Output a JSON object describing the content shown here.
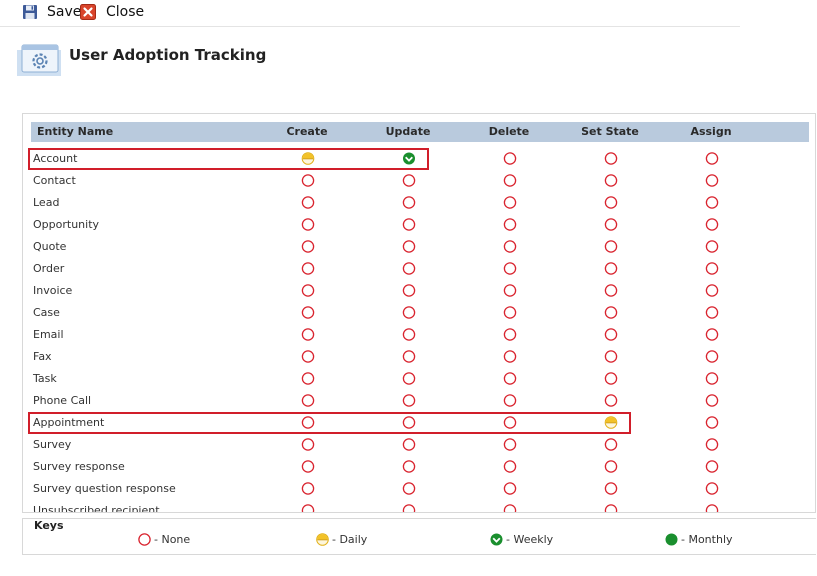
{
  "toolbar": {
    "save_label": "Save",
    "close_label": "Close"
  },
  "header": {
    "title": "User Adoption Tracking"
  },
  "grid": {
    "columns": [
      "Entity Name",
      "Create",
      "Update",
      "Delete",
      "Set State",
      "Assign"
    ],
    "rows": [
      {
        "entity": "Account",
        "states": [
          "daily",
          "weekly",
          "none",
          "none",
          "none"
        ],
        "highlight": true
      },
      {
        "entity": "Contact",
        "states": [
          "none",
          "none",
          "none",
          "none",
          "none"
        ]
      },
      {
        "entity": "Lead",
        "states": [
          "none",
          "none",
          "none",
          "none",
          "none"
        ]
      },
      {
        "entity": "Opportunity",
        "states": [
          "none",
          "none",
          "none",
          "none",
          "none"
        ]
      },
      {
        "entity": "Quote",
        "states": [
          "none",
          "none",
          "none",
          "none",
          "none"
        ]
      },
      {
        "entity": "Order",
        "states": [
          "none",
          "none",
          "none",
          "none",
          "none"
        ]
      },
      {
        "entity": "Invoice",
        "states": [
          "none",
          "none",
          "none",
          "none",
          "none"
        ]
      },
      {
        "entity": "Case",
        "states": [
          "none",
          "none",
          "none",
          "none",
          "none"
        ]
      },
      {
        "entity": "Email",
        "states": [
          "none",
          "none",
          "none",
          "none",
          "none"
        ]
      },
      {
        "entity": "Fax",
        "states": [
          "none",
          "none",
          "none",
          "none",
          "none"
        ]
      },
      {
        "entity": "Task",
        "states": [
          "none",
          "none",
          "none",
          "none",
          "none"
        ]
      },
      {
        "entity": "Phone Call",
        "states": [
          "none",
          "none",
          "none",
          "none",
          "none"
        ]
      },
      {
        "entity": "Appointment",
        "states": [
          "none",
          "none",
          "none",
          "daily",
          "none"
        ],
        "highlight": true
      },
      {
        "entity": "Survey",
        "states": [
          "none",
          "none",
          "none",
          "none",
          "none"
        ]
      },
      {
        "entity": "Survey response",
        "states": [
          "none",
          "none",
          "none",
          "none",
          "none"
        ]
      },
      {
        "entity": "Survey question response",
        "states": [
          "none",
          "none",
          "none",
          "none",
          "none"
        ]
      },
      {
        "entity": "Unsubscribed recipient",
        "states": [
          "none",
          "none",
          "none",
          "none",
          "none"
        ]
      }
    ]
  },
  "keys": {
    "title": "Keys",
    "items": [
      {
        "state": "none",
        "label": "- None"
      },
      {
        "state": "daily",
        "label": "- Daily"
      },
      {
        "state": "weekly",
        "label": "- Weekly"
      },
      {
        "state": "monthly",
        "label": "- Monthly"
      }
    ]
  },
  "colors": {
    "none": "#d9232e",
    "daily_top": "#f3c227",
    "weekly": "#1a8f2e",
    "monthly": "#1a8f2e",
    "header_bar": "#b9cadd",
    "highlight": "#d11e2a"
  },
  "icons": {
    "save": "floppy-disk-icon",
    "close": "red-x-icon",
    "header": "gear-window-icon"
  }
}
